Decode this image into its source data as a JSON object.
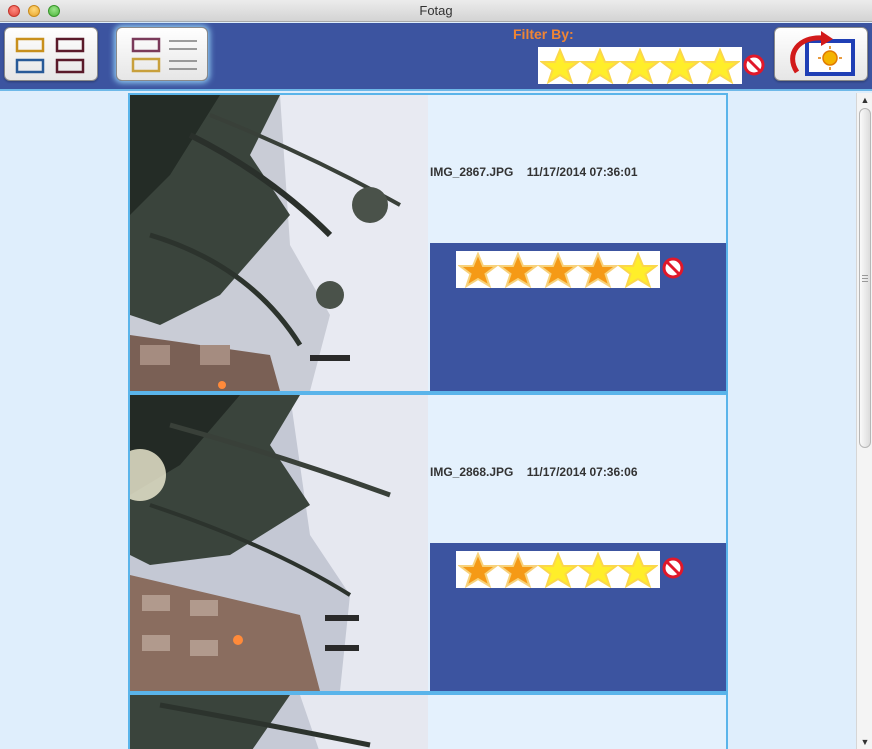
{
  "window": {
    "title": "Fotag"
  },
  "toolbar": {
    "grid_view_icon": "grid-view-icon",
    "list_view_icon": "list-view-icon",
    "rotate_icon": "rotate-image-icon",
    "filter_label": "Filter By:",
    "filter_rating": 5,
    "filter_clear_icon": "no-sign-icon"
  },
  "colors": {
    "toolbar_bg": "#3c54a0",
    "filter_label": "#ef8534",
    "row_bg": "#e4f1fd",
    "border": "#5ab4ea"
  },
  "photos": [
    {
      "name": "IMG_2867.JPG",
      "datetime": "11/17/2014 07:36:01",
      "rating": 4
    },
    {
      "name": "IMG_2868.JPG",
      "datetime": "11/17/2014 07:36:06",
      "rating": 2
    },
    {
      "name": "",
      "datetime": "",
      "rating": 0
    }
  ]
}
